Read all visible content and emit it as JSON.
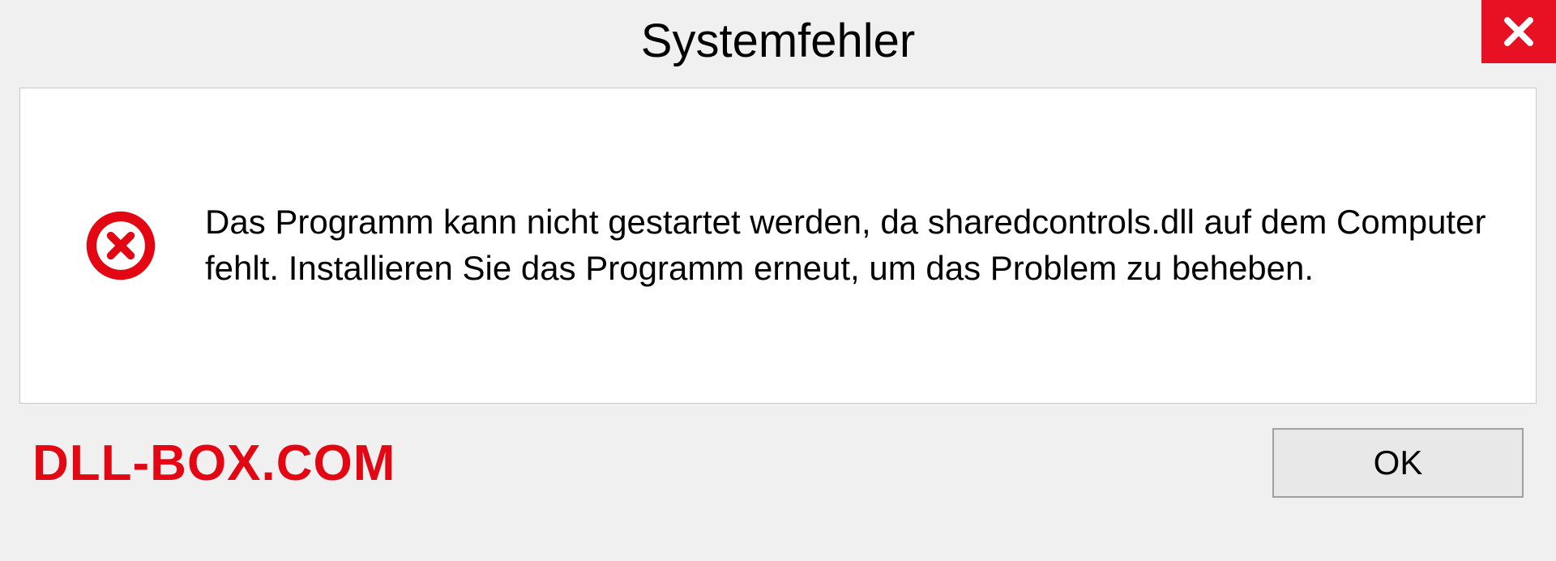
{
  "dialog": {
    "title": "Systemfehler",
    "message": "Das Programm kann nicht gestartet werden, da sharedcontrols.dll auf dem Computer fehlt. Installieren Sie das Programm erneut, um das Problem zu beheben.",
    "ok_label": "OK"
  },
  "watermark": "DLL-BOX.COM",
  "colors": {
    "close_bg": "#e81123",
    "watermark": "#e30613"
  }
}
